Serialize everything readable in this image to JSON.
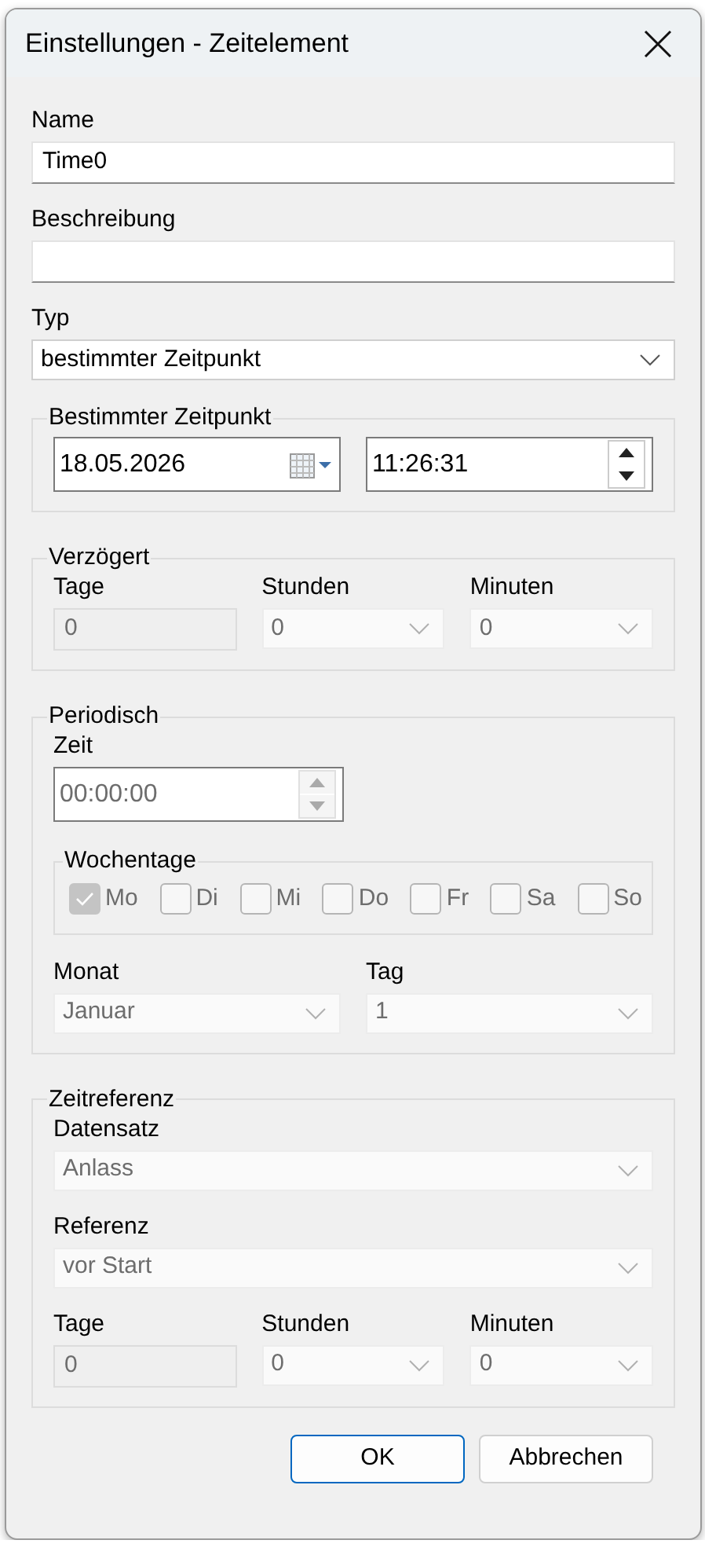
{
  "window": {
    "title": "Einstellungen - Zeitelement"
  },
  "name": {
    "label": "Name",
    "value": "Time0"
  },
  "description": {
    "label": "Beschreibung"
  },
  "type": {
    "label": "Typ",
    "value": "bestimmter Zeitpunkt"
  },
  "specific_time": {
    "title": "Bestimmter Zeitpunkt",
    "date": "18.05.2026",
    "time": "11:26:31"
  },
  "delayed": {
    "title": "Verzögert",
    "fields": [
      {
        "kind": "text",
        "label": "Tage",
        "value": "0",
        "disabled": true
      },
      {
        "kind": "select",
        "label": "Stunden",
        "value": "0",
        "disabled": true
      },
      {
        "kind": "select",
        "label": "Minuten",
        "value": "0",
        "disabled": true
      }
    ]
  },
  "periodic": {
    "title": "Periodisch",
    "time": {
      "label": "Zeit",
      "value": "00:00:00",
      "disabled": true
    },
    "weekdays": {
      "title": "Wochentage",
      "days": [
        {
          "label": "Mo",
          "checked": true,
          "disabled": true
        },
        {
          "label": "Di",
          "checked": false,
          "disabled": true
        },
        {
          "label": "Mi",
          "checked": false,
          "disabled": true
        },
        {
          "label": "Do",
          "checked": false,
          "disabled": true
        },
        {
          "label": "Fr",
          "checked": false,
          "disabled": true
        },
        {
          "label": "Sa",
          "checked": false,
          "disabled": true
        },
        {
          "label": "So",
          "checked": false,
          "disabled": true
        }
      ]
    },
    "fields": [
      {
        "kind": "select",
        "label": "Monat",
        "value": "Januar",
        "disabled": true
      },
      {
        "kind": "select",
        "label": "Tag",
        "value": "1",
        "disabled": true
      }
    ]
  },
  "time_reference": {
    "title": "Zeitreferenz",
    "rows": [
      [
        {
          "kind": "select",
          "label": "Datensatz",
          "value": "Anlass",
          "disabled": true
        }
      ],
      [
        {
          "kind": "select",
          "label": "Referenz",
          "value": "vor Start",
          "disabled": true
        }
      ],
      [
        {
          "kind": "text",
          "label": "Tage",
          "value": "0",
          "disabled": true
        },
        {
          "kind": "select",
          "label": "Stunden",
          "value": "0",
          "disabled": true
        },
        {
          "kind": "select",
          "label": "Minuten",
          "value": "0",
          "disabled": true
        }
      ]
    ]
  },
  "buttons": [
    {
      "label": "OK",
      "default": true
    },
    {
      "label": "Abbrechen",
      "default": false
    }
  ]
}
